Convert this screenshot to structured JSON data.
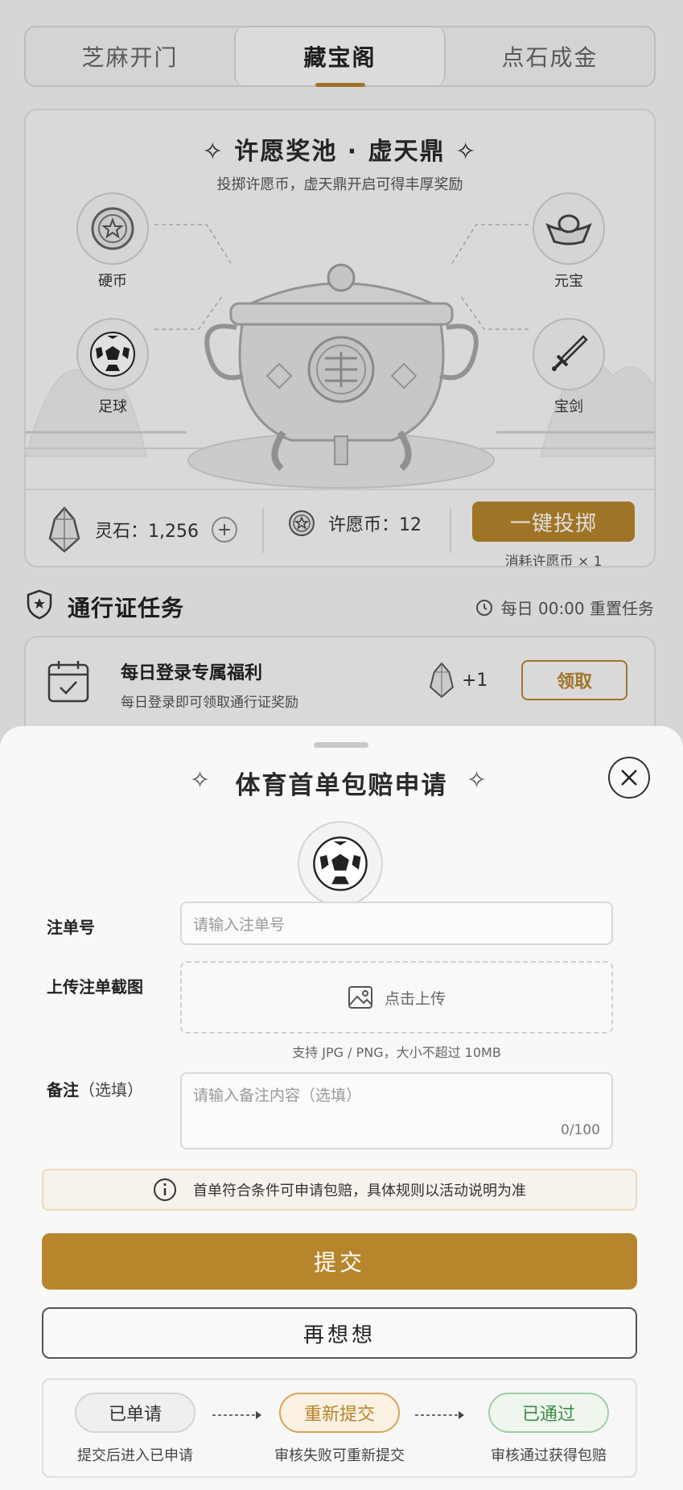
{
  "tabs": [
    {
      "label": "芝麻开门",
      "active": false
    },
    {
      "label": "藏宝阁",
      "active": true
    },
    {
      "label": "点石成金",
      "active": false
    }
  ],
  "pool": {
    "title": "✧ 许愿奖池 · 虚天鼎 ✧",
    "subtitle": "投掷许愿币，虚天鼎开启可得丰厚奖励",
    "rewards": [
      "硬币",
      "足球",
      "元宝",
      "宝剑"
    ],
    "lingshi_text": "灵石：1,256",
    "coin_text": "许愿币：12",
    "throw_label": "一键投掷",
    "throw_note": "消耗许愿币 × 1"
  },
  "pass": {
    "title": "通行证任务",
    "reset_text": "每日 00:00 重置任务",
    "task": {
      "title": "每日登录专属福利",
      "subtitle": "每日登录即可领取通行证奖励",
      "reward": "+1",
      "claim_label": "领取"
    }
  },
  "sheet": {
    "title": "体育首单包赔申请",
    "fields": {
      "ticket_label": "注单号",
      "ticket_placeholder": "请输入注单号",
      "screenshot_label": "上传注单截图",
      "upload_label": "点击上传",
      "upload_hint": "支持 JPG / PNG，大小不超过 10MB",
      "note_label": "备注",
      "note_optional": "（选填）",
      "note_placeholder": "请输入备注内容（选填）",
      "note_counter": "0/100"
    },
    "notice": "首单符合条件可申请包赔，具体规则以活动说明为准",
    "submit_label": "提交",
    "rethink_label": "再想想",
    "flow": [
      {
        "label": "已单请",
        "desc": "提交后进入已申请"
      },
      {
        "label": "重新提交",
        "desc": "审核失败可重新提交"
      },
      {
        "label": "已通过",
        "desc": "审核通过获得包赔"
      }
    ]
  },
  "colors": {
    "accent": "#b7852c",
    "success": "#3e8a47"
  }
}
